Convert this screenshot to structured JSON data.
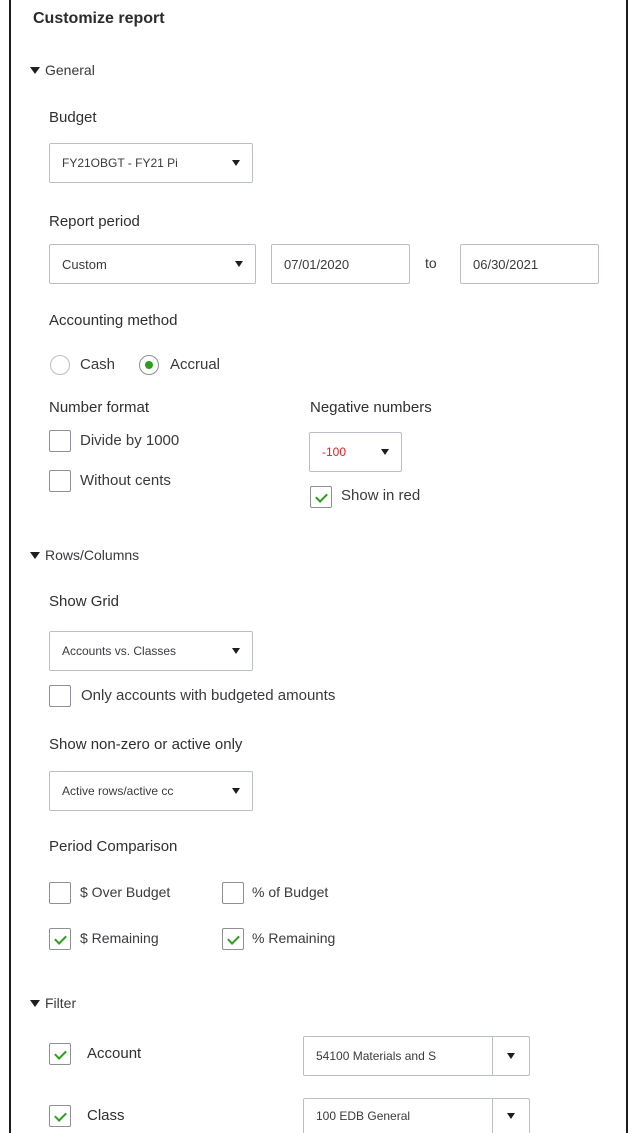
{
  "panel": {
    "title": "Customize report"
  },
  "general": {
    "section_label": "General",
    "budget": {
      "label": "Budget",
      "value": "FY21OBGT - FY21 Pi"
    },
    "report_period": {
      "label": "Report period",
      "preset": "Custom",
      "from": "07/01/2020",
      "to_label": "to",
      "to": "06/30/2021"
    },
    "accounting_method": {
      "label": "Accounting method",
      "options": [
        "Cash",
        "Accrual"
      ],
      "selected": "Accrual"
    },
    "number_format": {
      "label": "Number format",
      "divide_by_1000": "Divide by 1000",
      "without_cents": "Without cents"
    },
    "negative_numbers": {
      "label": "Negative numbers",
      "value": "-100",
      "show_in_red": "Show in red",
      "value_color": "#e02020"
    }
  },
  "rows_columns": {
    "section_label": "Rows/Columns",
    "show_grid": {
      "label": "Show Grid",
      "value": "Accounts vs. Classes",
      "only_budgeted": "Only accounts with budgeted amounts"
    },
    "non_zero": {
      "label": "Show non-zero or active only",
      "value": "Active rows/active cc"
    },
    "period_comparison": {
      "label": "Period Comparison",
      "over_budget": "$ Over Budget",
      "pct_of_budget": "% of Budget",
      "remaining": "$ Remaining",
      "pct_remaining": "% Remaining"
    }
  },
  "filter": {
    "section_label": "Filter",
    "account": {
      "label": "Account",
      "value": "54100 Materials and S"
    },
    "class": {
      "label": "Class",
      "value": "100 EDB General"
    }
  },
  "colors": {
    "accent_green": "#2ca01c",
    "border": "#babec5",
    "text": "#393a3d"
  }
}
